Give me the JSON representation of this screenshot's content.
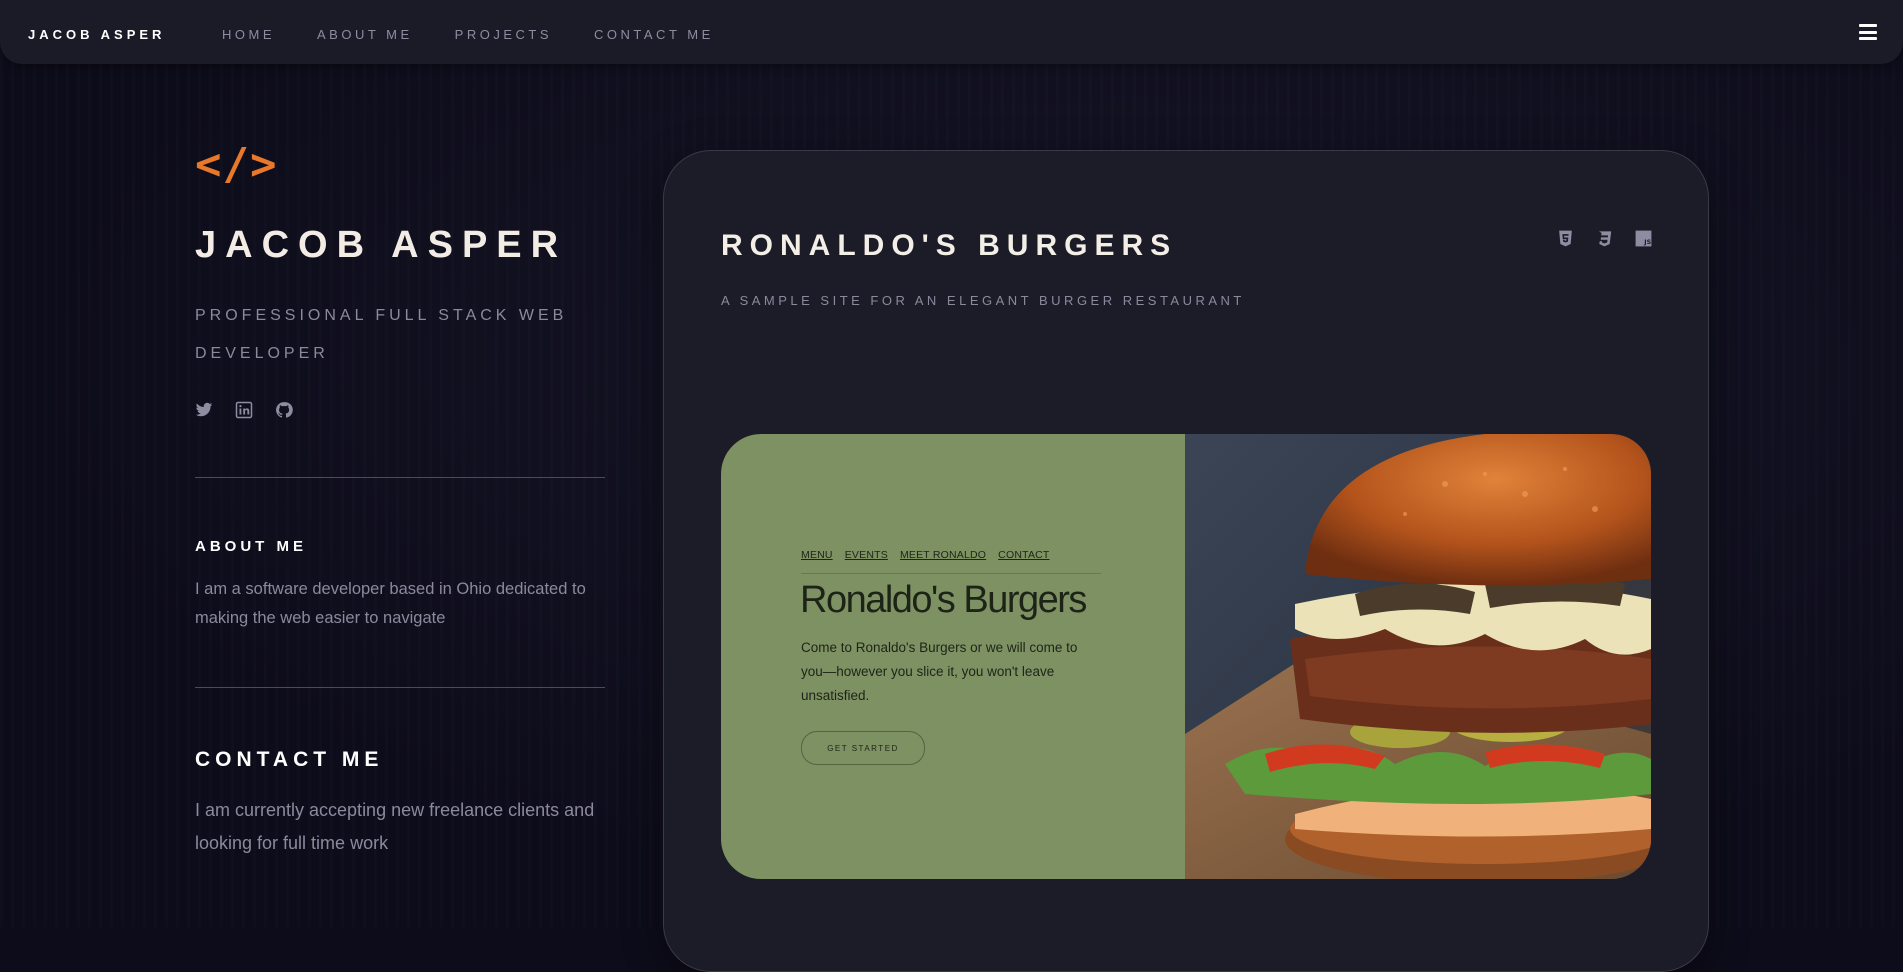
{
  "nav": {
    "brand": "JACOB ASPER",
    "links": [
      "HOME",
      "ABOUT ME",
      "PROJECTS",
      "CONTACT ME"
    ]
  },
  "hero": {
    "logo": "</>",
    "name": "JACOB ASPER",
    "subtitle": "PROFESSIONAL FULL STACK WEB DEVELOPER",
    "socials": [
      "twitter-icon",
      "linkedin-icon",
      "github-icon"
    ]
  },
  "about": {
    "title": "ABOUT ME",
    "text": "I am a software developer based in Ohio dedicated to making the web easier to navigate"
  },
  "contact": {
    "title": "CONTACT ME",
    "text": "I am currently accepting new freelance clients and looking for full time work"
  },
  "project": {
    "title": "RONALDO'S BURGERS",
    "subtitle": "A SAMPLE SITE FOR AN ELEGANT BURGER RESTAURANT",
    "tech_icons": [
      "html5-icon",
      "css3-icon",
      "javascript-icon"
    ],
    "preview": {
      "nav": [
        "MENU",
        "EVENTS",
        "MEET RONALDO",
        "CONTACT"
      ],
      "title": "Ronaldo's Burgers",
      "text": "Come to Ronaldo's Burgers or we will come to you—however you slice it, you won't leave unsatisfied.",
      "button": "GET STARTED"
    }
  },
  "colors": {
    "background": "#0d0c1a",
    "accent": "#e8792a",
    "card": "#1c1b28",
    "preview_green": "#7d9163"
  }
}
